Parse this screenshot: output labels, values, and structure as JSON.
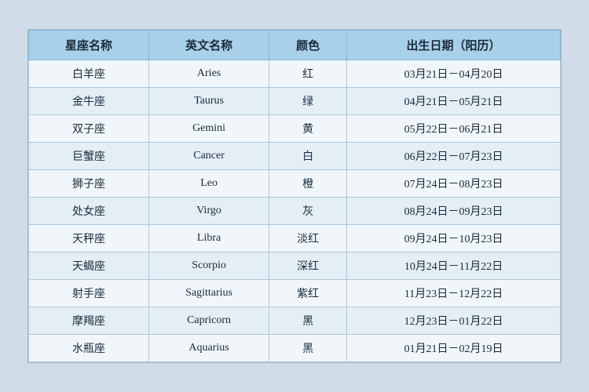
{
  "table": {
    "headers": [
      "星座名称",
      "英文名称",
      "颜色",
      "出生日期（阳历）"
    ],
    "rows": [
      [
        "白羊座",
        "Aries",
        "红",
        "03月21日－04月20日"
      ],
      [
        "金牛座",
        "Taurus",
        "绿",
        "04月21日－05月21日"
      ],
      [
        "双子座",
        "Gemini",
        "黄",
        "05月22日－06月21日"
      ],
      [
        "巨蟹座",
        "Cancer",
        "白",
        "06月22日－07月23日"
      ],
      [
        "狮子座",
        "Leo",
        "橙",
        "07月24日－08月23日"
      ],
      [
        "处女座",
        "Virgo",
        "灰",
        "08月24日－09月23日"
      ],
      [
        "天秤座",
        "Libra",
        "淡红",
        "09月24日－10月23日"
      ],
      [
        "天蝎座",
        "Scorpio",
        "深红",
        "10月24日－11月22日"
      ],
      [
        "射手座",
        "Sagittarius",
        "紫红",
        "11月23日－12月22日"
      ],
      [
        "摩羯座",
        "Capricorn",
        "黑",
        "12月23日－01月22日"
      ],
      [
        "水瓶座",
        "Aquarius",
        "黑",
        "01月21日－02月19日"
      ]
    ]
  }
}
